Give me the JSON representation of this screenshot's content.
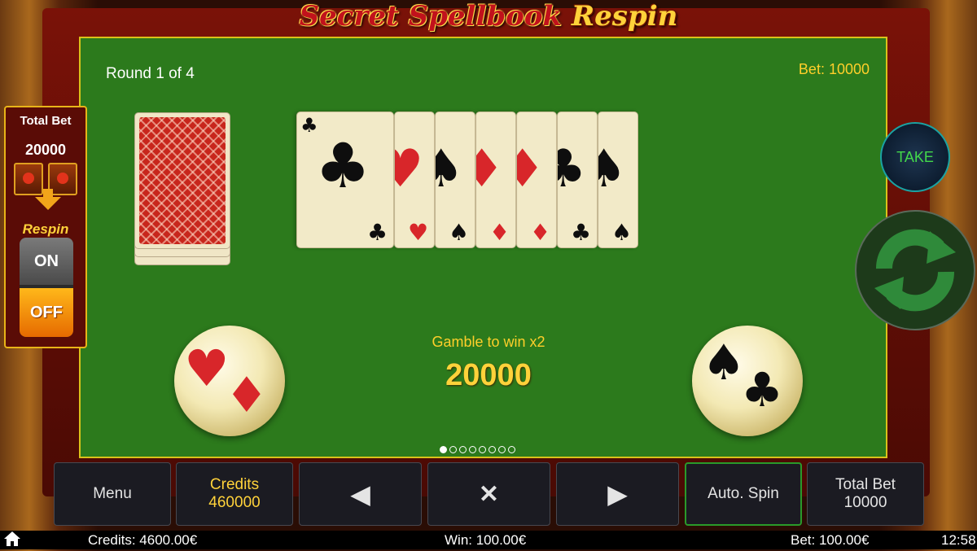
{
  "game_title": {
    "main": "Secret Spellbook",
    "suffix": "Respin"
  },
  "round": "Round 1 of 4",
  "bet_label": "Bet: 10000",
  "gamble": {
    "label": "Gamble to win x2",
    "value": "20000"
  },
  "left_panel": {
    "title": "Total Bet",
    "value": "20000",
    "respin_label": "Respin",
    "on_label": "ON",
    "off_label": "OFF"
  },
  "take_label": "TAKE",
  "history_cards": [
    {
      "suit": "clubs",
      "symbol": "♣",
      "color": "black"
    },
    {
      "suit": "hearts",
      "symbol": "♥",
      "color": "red"
    },
    {
      "suit": "spades",
      "symbol": "♠",
      "color": "black"
    },
    {
      "suit": "diamonds",
      "symbol": "♦",
      "color": "red"
    },
    {
      "suit": "diamonds",
      "symbol": "♦",
      "color": "red"
    },
    {
      "suit": "clubs",
      "symbol": "♣",
      "color": "black"
    },
    {
      "suit": "spades",
      "symbol": "♠",
      "color": "black"
    }
  ],
  "pagination": {
    "total": 8,
    "active": 1
  },
  "buttons": {
    "menu": "Menu",
    "credits_label": "Credits",
    "credits_value": "460000",
    "prev_icon": "◀",
    "close_icon": "✕",
    "next_icon": "▶",
    "autospin": "Auto. Spin",
    "total_bet_label": "Total Bet",
    "total_bet_value": "10000"
  },
  "status_bar": {
    "home_icon": "home-icon",
    "credits": "Credits: 4600.00€",
    "win": "Win: 100.00€",
    "bet": "Bet: 100.00€",
    "time": "12:58"
  },
  "colors": {
    "table": "#2c7a1c",
    "gold": "#ffd23a",
    "red_suit": "#d8262a"
  }
}
